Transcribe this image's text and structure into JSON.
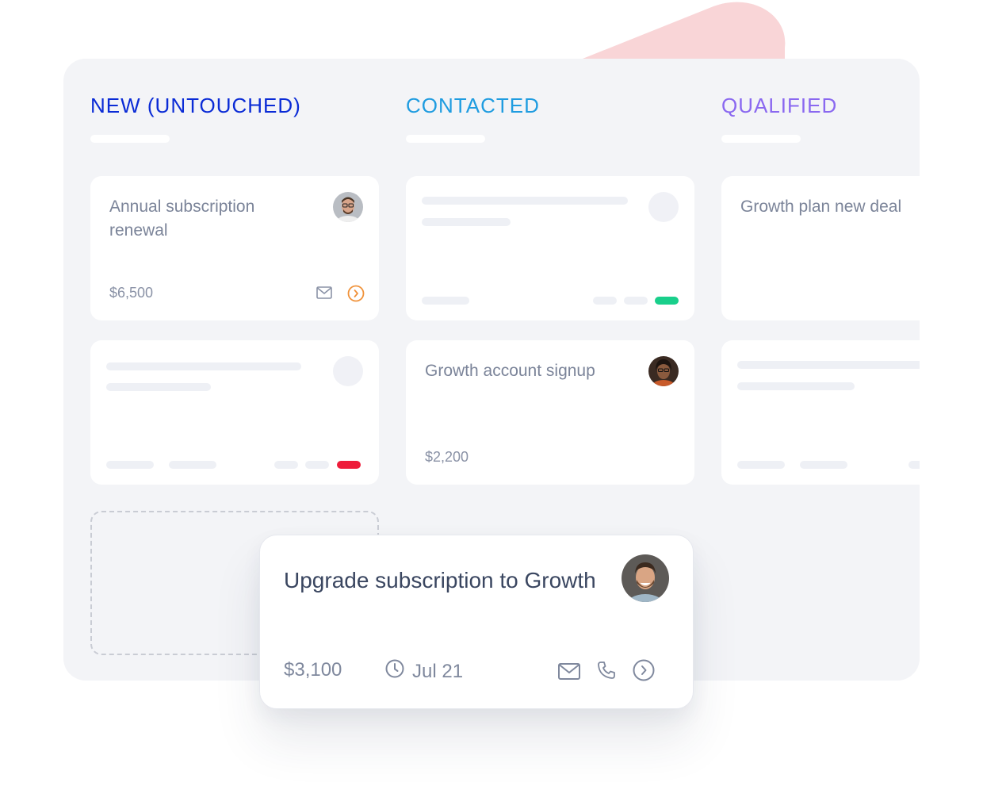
{
  "colors": {
    "col_new": "#0a2bd6",
    "col_contacted": "#1f9ce0",
    "col_qualified": "#8a68f0",
    "accent_orange": "#f0923a",
    "status_green": "#19cf8b",
    "status_red": "#ee1c3a",
    "deco_pink": "#f9d5d7"
  },
  "columns": [
    {
      "title": "NEW (UNTOUCHED)"
    },
    {
      "title": "CONTACTED"
    },
    {
      "title": "QUALIFIED"
    }
  ],
  "cards": {
    "annual_renewal": {
      "title": "Annual subscription renewal",
      "amount": "$6,500",
      "avatar_icon": "avatar-man-glasses",
      "actions": [
        "mail-icon",
        "arrow-circle-right-icon"
      ]
    },
    "growth_signup": {
      "title": "Growth account signup",
      "amount": "$2,200",
      "avatar_icon": "avatar-woman-glasses"
    },
    "growth_plan": {
      "title": "Growth plan new deal"
    },
    "skeleton_contacted": {
      "status": "green"
    },
    "skeleton_new": {
      "status": "red"
    }
  },
  "dragging_card": {
    "title": "Upgrade subscription to Growth",
    "amount": "$3,100",
    "date": "Jul 21",
    "date_icon": "clock-icon",
    "avatar_icon": "avatar-man-smiling",
    "actions": [
      "mail-icon",
      "phone-icon",
      "arrow-circle-right-icon"
    ]
  },
  "dropzone": {
    "label": ""
  }
}
